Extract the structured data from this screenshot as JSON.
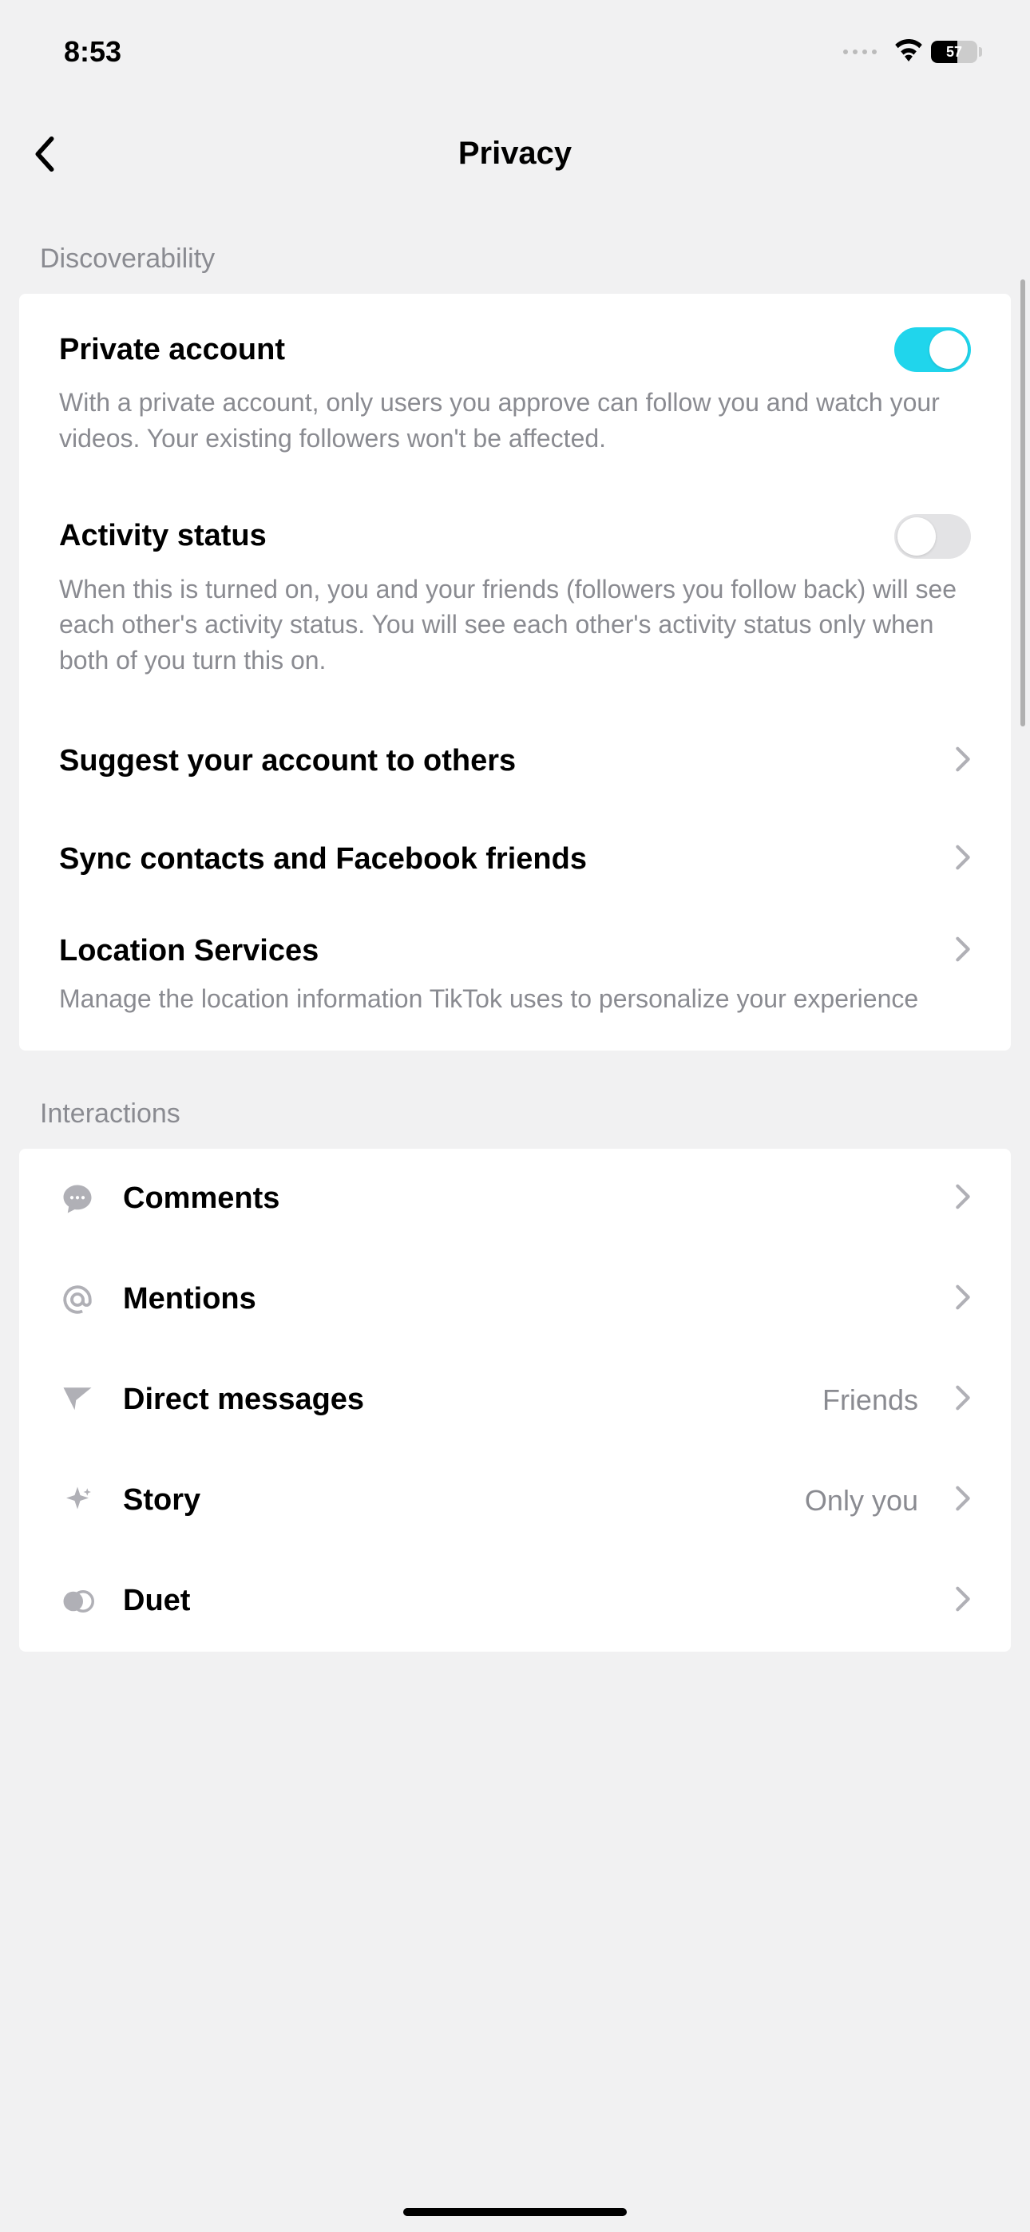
{
  "status": {
    "time": "8:53",
    "battery": "57"
  },
  "header": {
    "title": "Privacy"
  },
  "sections": {
    "discoverability": {
      "header": "Discoverability",
      "private_account": {
        "title": "Private account",
        "desc": "With a private account, only users you approve can follow you and watch your videos. Your existing followers won't be affected.",
        "enabled": true
      },
      "activity_status": {
        "title": "Activity status",
        "desc": "When this is turned on, you and your friends (followers you follow back) will see each other's activity status. You will see each other's activity status only when both of you turn this on.",
        "enabled": false
      },
      "suggest": {
        "title": "Suggest your account to others"
      },
      "sync": {
        "title": "Sync contacts and Facebook friends"
      },
      "location": {
        "title": "Location Services",
        "desc": "Manage the location information TikTok uses to personalize your experience"
      }
    },
    "interactions": {
      "header": "Interactions",
      "items": [
        {
          "icon": "comment",
          "label": "Comments",
          "value": ""
        },
        {
          "icon": "mention",
          "label": "Mentions",
          "value": ""
        },
        {
          "icon": "send",
          "label": "Direct messages",
          "value": "Friends"
        },
        {
          "icon": "sparkle",
          "label": "Story",
          "value": "Only you"
        },
        {
          "icon": "duet",
          "label": "Duet",
          "value": ""
        }
      ]
    }
  }
}
